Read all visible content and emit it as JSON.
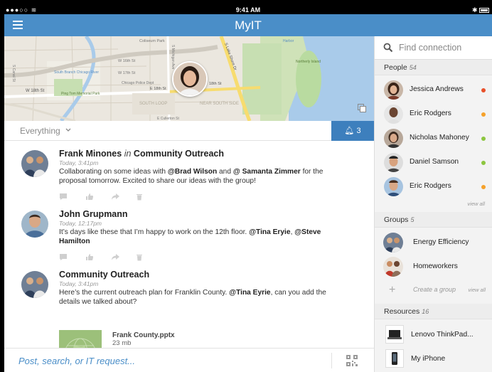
{
  "status_bar": {
    "signal": "●●●○○",
    "time": "9:41 AM",
    "bluetooth": "✱"
  },
  "nav": {
    "title": "MyIT",
    "menu_icon": "hamburger-icon"
  },
  "map": {
    "labels": [
      "Coliseum Park",
      "W 16th St",
      "W 17th St",
      "Chicago Police Dept",
      "South Branch Chicago River",
      "W 18th St",
      "Ping Tom Memorial Park",
      "E 18th St",
      "18th St",
      "S Lake Shore Dr",
      "Northerly Island",
      "SOUTH LOOP",
      "NEAR SOUTH SIDE",
      "E Cullerton St",
      "S Canal St",
      "S Michigan Ave",
      "Harbor"
    ]
  },
  "filter": {
    "label": "Everything",
    "notifications_count": "3"
  },
  "posts": [
    {
      "author": "Frank Minones",
      "in_word": "in",
      "group": "Community Outreach",
      "time": "Today, 3:41pm",
      "text_1": "Collaborating on some ideas with ",
      "mention_1": "@Brad Wilson",
      "text_2": " and ",
      "mention_2": "@ Samanta Zimmer",
      "text_3": " for the proposal tomorrow. Excited to share our ideas with the group!"
    },
    {
      "author": "John Grupmann",
      "time": "Today, 12:17pm",
      "text_1": "It’s days like these that I’m happy to work on the 12th floor. ",
      "mention_1": "@Tina Eryie",
      "text_2": ", ",
      "mention_2": "@Steve Hamilton"
    },
    {
      "author": "Community Outreach",
      "time": "Today, 3:41pm",
      "text_1": "Here’s the current outreach plan for Franklin County. ",
      "mention_1": "@Tina Eyrie",
      "text_2": ", can you add the details we talked about?",
      "attachment": {
        "name": "Frank County.pptx",
        "size": "23 mb"
      }
    }
  ],
  "input": {
    "placeholder": "Post, search, or IT request..."
  },
  "sidebar": {
    "search_placeholder": "Find connection",
    "people_header": "People",
    "people_count": "54",
    "people": [
      {
        "name": "Jessica Andrews",
        "status_color": "#e8502a"
      },
      {
        "name": "Eric Rodgers",
        "status_color": "#f5a12a"
      },
      {
        "name": "Nicholas Mahoney",
        "status_color": "#8cc63f"
      },
      {
        "name": "Daniel Samson",
        "status_color": "#8cc63f"
      },
      {
        "name": "Eric Rodgers",
        "status_color": "#f5a12a"
      }
    ],
    "view_all": "view all",
    "groups_header": "Groups",
    "groups_count": "5",
    "groups": [
      {
        "name": "Energy Efficiency"
      },
      {
        "name": "Homeworkers"
      }
    ],
    "create_group": "Create a group",
    "resources_header": "Resources",
    "resources_count": "16",
    "resources": [
      {
        "name": "Lenovo ThinkPad..."
      },
      {
        "name": "My iPhone"
      }
    ]
  },
  "colors": {
    "nav_blue": "#4a8ec8",
    "notify_blue": "#3d7fbd"
  }
}
